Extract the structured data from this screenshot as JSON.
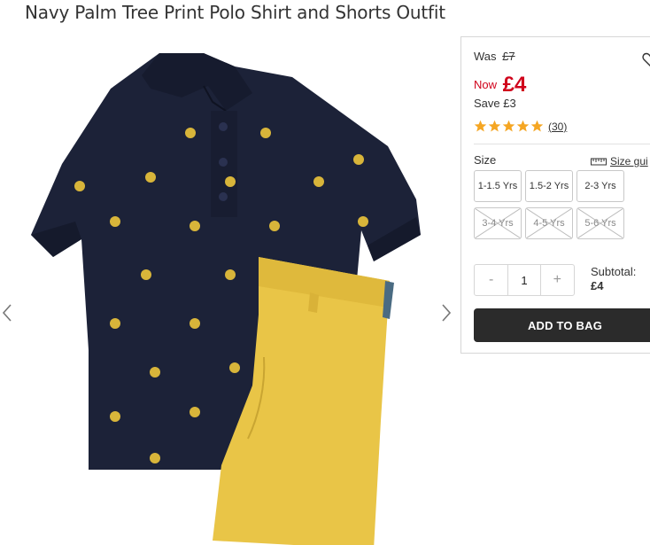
{
  "product": {
    "title": "Navy Palm Tree Print Polo Shirt and Shorts Outfit",
    "image_icon": "polo-shirt-and-shorts-image"
  },
  "pricing": {
    "was_label": "Was",
    "was_price": "£7",
    "now_label": "Now",
    "now_price": "£4",
    "save_text": "Save £3",
    "sale_color": "#d0021b"
  },
  "rating": {
    "stars": 5,
    "max": 5,
    "count": "(30)",
    "star_color": "#f5a623"
  },
  "size": {
    "label": "Size",
    "guide_label": "Size gui",
    "options": [
      {
        "label": "1-1.5 Yrs",
        "available": true
      },
      {
        "label": "1.5-2 Yrs",
        "available": true
      },
      {
        "label": "2-3 Yrs",
        "available": true
      },
      {
        "label": "3-4 Yrs",
        "available": false
      },
      {
        "label": "4-5 Yrs",
        "available": false
      },
      {
        "label": "5-6 Yrs",
        "available": false
      }
    ]
  },
  "quantity": {
    "minus": "-",
    "value": "1",
    "plus": "+"
  },
  "subtotal": {
    "label": "Subtotal:",
    "amount": "£4"
  },
  "cta": {
    "add_to_bag": "ADD TO BAG",
    "button_color": "#2b2b2b"
  }
}
